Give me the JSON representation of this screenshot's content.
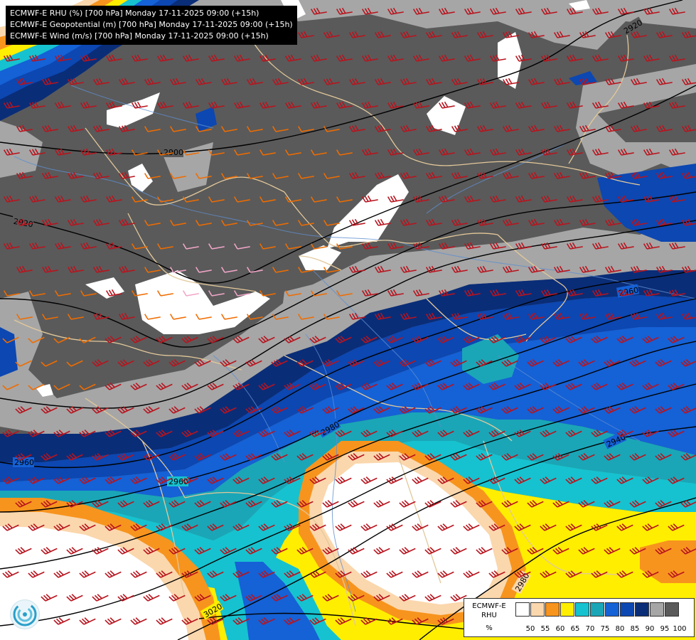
{
  "header": {
    "lines": [
      "ECMWF-E RHU (%) [700 hPa] Monday 17-11-2025 09:00 (+15h)",
      "ECMWF-E Geopotential (m) [700 hPa] Monday 17-11-2025 09:00 (+15h)",
      "ECMWF-E Wind (m/s) [700 hPa] Monday 17-11-2025 09:00 (+15h)"
    ]
  },
  "contours": {
    "labels": [
      "2920",
      "2900",
      "2920",
      "2960",
      "2980",
      "3000",
      "3020",
      "2940",
      "2960",
      "2960",
      "2980",
      "3020"
    ]
  },
  "legend": {
    "title_line1": "ECMWF-E",
    "title_line2": "RHU",
    "unit": "%",
    "classes": [
      {
        "value": "50",
        "color": "#ffffff"
      },
      {
        "value": "55",
        "color": "#fbd7ad"
      },
      {
        "value": "60",
        "color": "#f7941e"
      },
      {
        "value": "65",
        "color": "#ffee00"
      },
      {
        "value": "70",
        "color": "#16c2cf"
      },
      {
        "value": "75",
        "color": "#1aa6b7"
      },
      {
        "value": "80",
        "color": "#1561d6"
      },
      {
        "value": "85",
        "color": "#0c47b2"
      },
      {
        "value": "90",
        "color": "#0a2d78"
      },
      {
        "value": "95",
        "color": "#a6a6a6"
      },
      {
        "value": "100",
        "color": "#5a5a5a"
      }
    ]
  },
  "colors": {
    "wind_barb": "#b8141e",
    "wind_barb_weak": "#f06c00",
    "wind_barb_calm": "#f2a6c8",
    "border": "#e2c89a",
    "river": "#5f8fd0",
    "contour": "#000000"
  }
}
